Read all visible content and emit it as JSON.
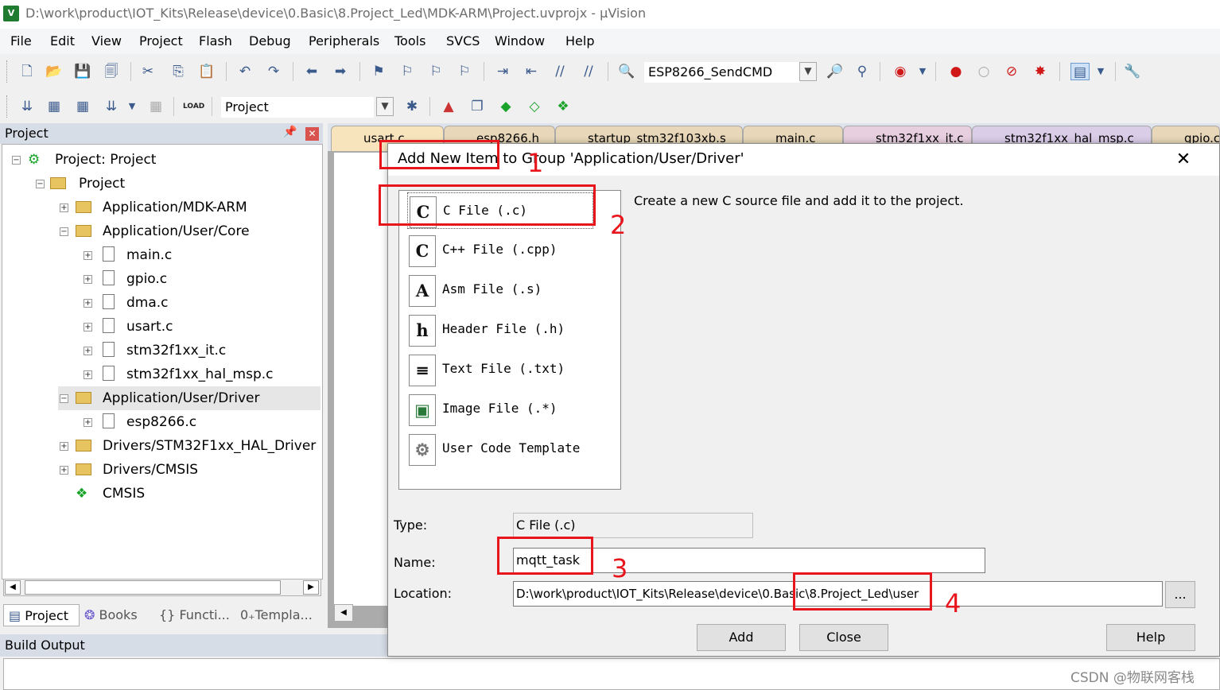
{
  "window": {
    "title": "D:\\work\\product\\IOT_Kits\\Release\\device\\0.Basic\\8.Project_Led\\MDK-ARM\\Project.uvprojx - µVision",
    "app_icon_text": "V"
  },
  "menu": [
    "File",
    "Edit",
    "View",
    "Project",
    "Flash",
    "Debug",
    "Peripherals",
    "Tools",
    "SVCS",
    "Window",
    "Help"
  ],
  "toolbar1": {
    "target_combo": "ESP8266_SendCMD"
  },
  "toolbar2": {
    "project_combo": "Project",
    "load_label": "LOAD"
  },
  "project_panel": {
    "title": "Project",
    "tree": [
      {
        "label": "Project: Project",
        "kind": "root",
        "toggle": "−"
      },
      {
        "label": "Project",
        "kind": "target",
        "toggle": "−"
      },
      {
        "label": "Application/MDK-ARM",
        "kind": "folder",
        "toggle": "+"
      },
      {
        "label": "Application/User/Core",
        "kind": "folder",
        "toggle": "−"
      },
      {
        "label": "main.c",
        "kind": "file",
        "toggle": "+"
      },
      {
        "label": "gpio.c",
        "kind": "file",
        "toggle": "+"
      },
      {
        "label": "dma.c",
        "kind": "file",
        "toggle": "+"
      },
      {
        "label": "usart.c",
        "kind": "file",
        "toggle": "+"
      },
      {
        "label": "stm32f1xx_it.c",
        "kind": "file",
        "toggle": "+"
      },
      {
        "label": "stm32f1xx_hal_msp.c",
        "kind": "file",
        "toggle": "+"
      },
      {
        "label": "Application/User/Driver",
        "kind": "folder",
        "toggle": "−"
      },
      {
        "label": "esp8266.c",
        "kind": "file",
        "toggle": "+"
      },
      {
        "label": "Drivers/STM32F1xx_HAL_Driver",
        "kind": "folder",
        "toggle": "+"
      },
      {
        "label": "Drivers/CMSIS",
        "kind": "folder",
        "toggle": "+"
      },
      {
        "label": "CMSIS",
        "kind": "gem",
        "toggle": ""
      }
    ],
    "bottom_tabs": [
      "Project",
      "Books",
      "Functi...",
      "Templa..."
    ]
  },
  "editor_tabs": [
    "usart.c",
    "esp8266.h",
    "startup_stm32f103xb.s",
    "main.c",
    "stm32f1xx_it.c",
    "stm32f1xx_hal_msp.c",
    "gpio.c"
  ],
  "build_output": {
    "title": "Build Output"
  },
  "watermark": "CSDN @物联网客栈",
  "dialog": {
    "title": "Add New Item to Group 'Application/User/Driver'",
    "close": "✕",
    "items": [
      {
        "icon": "C",
        "label": "C File (.c)"
      },
      {
        "icon": "C",
        "label": "C++ File (.cpp)"
      },
      {
        "icon": "A",
        "label": "Asm File (.s)"
      },
      {
        "icon": "h",
        "label": "Header File (.h)"
      },
      {
        "icon": "≡",
        "label": "Text File (.txt)"
      },
      {
        "icon": "▣",
        "label": "Image File (.*)"
      },
      {
        "icon": "⚙",
        "label": "User Code Template"
      }
    ],
    "description": "Create a new C source file and add it to the project.",
    "type_label": "Type:",
    "type_value": "C File (.c)",
    "name_label": "Name:",
    "name_value": "mqtt_task",
    "location_label": "Location:",
    "location_value": "D:\\work\\product\\IOT_Kits\\Release\\device\\0.Basic\\8.Project_Led\\user",
    "browse_label": "...",
    "add_label": "Add",
    "close_label": "Close",
    "help_label": "Help"
  },
  "annotations": [
    "1",
    "2",
    "3",
    "4"
  ],
  "colors": {
    "annotation": "#e8161c",
    "panel_header": "#d7dde7",
    "editor_tab": "#e8d7b8"
  }
}
